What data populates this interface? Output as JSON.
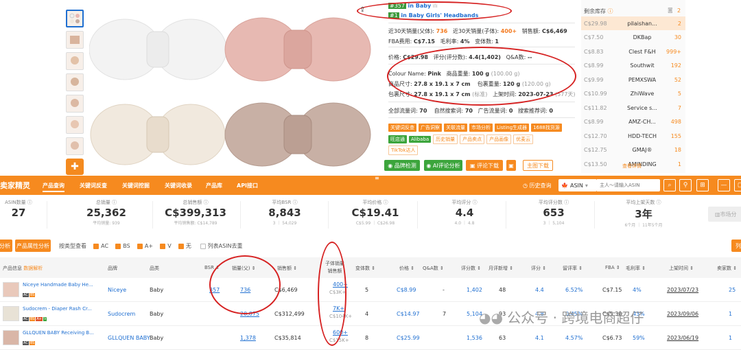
{
  "rank": {
    "badge1": "#357",
    "cat1": "in Baby",
    "badge2": "#1",
    "cat2": "in Baby Girls' Headbands"
  },
  "info": {
    "sales_parent_label": "近30天销量(父体):",
    "sales_parent": "736",
    "sales_child_label": "近30天销量(子体):",
    "sales_child": "400+",
    "revenue_label": "销售额:",
    "revenue": "C$6,469",
    "fba_label": "FBA费用:",
    "fba": "C$7.15",
    "margin_label": "毛利率:",
    "margin": "4%",
    "variants_label": "变体数:",
    "variants": "1",
    "price_label": "价格:",
    "price": "C$29.98",
    "rating_label": "评分(评分数):",
    "rating": "4.4(1,402)",
    "qa_label": "Q&A数:",
    "qa": "--",
    "color_label": "Colour Name:",
    "color": "Pink",
    "weight_label": "商品重量:",
    "weight": "100 g",
    "weight_alt": "(100.00 g)",
    "size_label": "商品尺寸:",
    "size": "27.8 x 19.1 x 7 cm",
    "pkg_weight_label": "包裹重量:",
    "pkg_weight": "120 g",
    "pkg_weight_alt": "(120.00 g)",
    "pkg_size_label": "包裹尺寸:",
    "pkg_size": "27.8 x 19.1 x 7 cm",
    "pkg_size_std": "(标准)",
    "listed_label": "上架时间:",
    "listed": "2023-07-23",
    "listed_days": "(577天)",
    "traffic_label": "全部流量词:",
    "traffic": "70",
    "organic_label": "自然搜索词:",
    "organic": "70",
    "ads_label": "广告流量词:",
    "ads": "0",
    "search_label": "搜索推荐词:",
    "search": "0"
  },
  "tags_row1": [
    "关键词反查",
    "广告洞察",
    "关联流量",
    "市场分析",
    "Listing生成器",
    "1688找货源"
  ],
  "tags_row2_green": [
    "旺店通",
    "Alibaba"
  ],
  "tags_row2_ghost": [
    "历史销量",
    "产品卖点",
    "产品画像",
    "优麦云"
  ],
  "tags_row3_ghost": [
    "TikTok达人"
  ],
  "actions": {
    "brand": "品牌检测",
    "ai": "AI评论分析",
    "review": "评论下载",
    "image": "主图下载"
  },
  "stock": {
    "title": "剩余库存",
    "count": "2",
    "more": "查看详情",
    "rows": [
      {
        "price": "C$29.98",
        "seller": "pilaishan...",
        "qty": "2"
      },
      {
        "price": "C$7.50",
        "seller": "DKBap",
        "qty": "30"
      },
      {
        "price": "C$8.83",
        "seller": "Clest F&H",
        "qty": "999+"
      },
      {
        "price": "C$8.99",
        "seller": "Southwit",
        "qty": "192"
      },
      {
        "price": "C$9.99",
        "seller": "PEMXSWA",
        "qty": "52"
      },
      {
        "price": "C$10.99",
        "seller": "ZhiWave",
        "qty": "5"
      },
      {
        "price": "C$11.82",
        "seller": "Service s...",
        "qty": "7"
      },
      {
        "price": "C$8.99",
        "seller": "AMZ-CH...",
        "qty": "498"
      },
      {
        "price": "C$12.70",
        "seller": "HDD-TECH",
        "qty": "155"
      },
      {
        "price": "C$12.75",
        "seller": "GMAJ®",
        "qty": "18"
      },
      {
        "price": "C$13.50",
        "seller": "AMINDING",
        "qty": "1"
      }
    ]
  },
  "nav": {
    "logo": "卖家精灵",
    "items": [
      "产品查询",
      "关键词反查",
      "关键词挖掘",
      "关键词收录",
      "产品库",
      "API接口"
    ],
    "history": "历史查询",
    "market": "ASIN",
    "search_placeholder": "主人～请输入ASIN"
  },
  "stats": [
    {
      "label": "ASIN数量",
      "value": "27",
      "sub": ""
    },
    {
      "label": "总销量",
      "value": "25,362",
      "sub": "平均销量: 939"
    },
    {
      "label": "总销售额",
      "value": "C$399,313",
      "sub": "平均销售额: C$14,789"
    },
    {
      "label": "平均BSR",
      "value": "8,843",
      "sub": "3 ｜ 54,029"
    },
    {
      "label": "平均价格",
      "value": "C$19.41",
      "sub": "C$5.99 ｜ C$26.98"
    },
    {
      "label": "平均评分",
      "value": "4.4",
      "sub": "4.0 ｜ 4.8"
    },
    {
      "label": "平均评分数",
      "value": "653",
      "sub": "3 ｜ 5,104"
    },
    {
      "label": "平均上架天数",
      "value": "3年",
      "sub": "6个月 ｜ 11年5个月"
    }
  ],
  "market_btn": "市场分",
  "filters": {
    "btn1": "分析",
    "btn2": "产品属性分析",
    "view_label": "按类型查看",
    "checks": [
      "AC",
      "BS",
      "A+",
      "V",
      "无"
    ],
    "dedupe": "列表ASIN去重",
    "right_btn": "列"
  },
  "table": {
    "headers": [
      "产品信息",
      "数据解析",
      "品牌",
      "品类",
      "BSR",
      "销量(父)",
      "销售额",
      "子体销量",
      "销售额",
      "变体数",
      "价格",
      "Q&A数",
      "评分数",
      "月评新增",
      "评分",
      "留评率",
      "FBA",
      "毛利率",
      "上架时间",
      "卖家数"
    ],
    "rows": [
      {
        "title": "Niceye Handmade Baby He...",
        "brand": "Niceye",
        "cat": "Baby",
        "bsr": "357",
        "sales": "736",
        "revenue": "C$6,469",
        "child_sales": "400+",
        "child_rev": "C$3K+",
        "variants": "5",
        "price": "C$8.99",
        "qa": "-",
        "ratings": "1,402",
        "monthly": "48",
        "score": "4.4",
        "review_rate": "6.52%",
        "fba": "C$7.15",
        "margin": "4%",
        "date": "2023/07/23",
        "sellers": "25"
      },
      {
        "title": "Sudocrem - Diaper Rash Cr...",
        "brand": "Sudocrem",
        "cat": "Baby",
        "bsr": "",
        "sales": "20,875",
        "revenue": "C$312,499",
        "child_sales": "7K+",
        "child_rev": "C$104K+",
        "variants": "4",
        "price": "C$14.97",
        "qa": "7",
        "ratings": "5,104",
        "monthly": "93",
        "score": "4.8",
        "review_rate": "0.45%",
        "fba": "C$5.30",
        "margin": "43%",
        "date": "2023/09/06",
        "sellers": "1"
      },
      {
        "title": "GLLQUEN BABY Receiving B...",
        "brand": "GLLQUEN BABY",
        "cat": "Baby",
        "bsr": "",
        "sales": "1,378",
        "revenue": "C$35,814",
        "child_sales": "600+",
        "child_rev": "C$15K+",
        "variants": "8",
        "price": "C$25.99",
        "qa": "",
        "ratings": "1,536",
        "monthly": "63",
        "score": "4.1",
        "review_rate": "4.57%",
        "fba": "C$6.73",
        "margin": "59%",
        "date": "2023/06/19",
        "sellers": "1"
      }
    ]
  },
  "watermark": "公众号 · 跨境电商超仔",
  "colors": {
    "accent": "#f68a1f",
    "link": "#1f6fd1",
    "annotation": "#d62222"
  }
}
